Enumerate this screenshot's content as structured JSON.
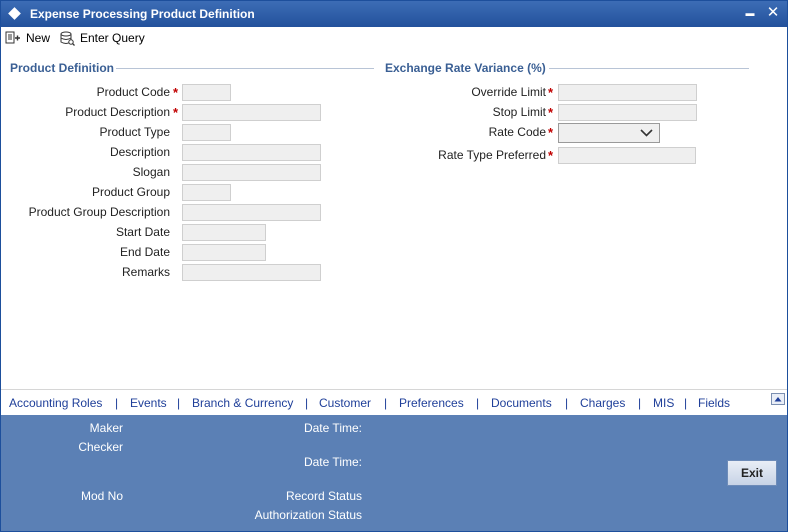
{
  "window": {
    "title": "Expense Processing Product Definition",
    "minimize_label": "▬",
    "close_label": "✕"
  },
  "toolbar": {
    "new_label": "New",
    "enter_query_label": "Enter Query"
  },
  "product_definition": {
    "heading": "Product Definition",
    "fields": {
      "product_code": {
        "label": "Product Code",
        "value": "",
        "required": true
      },
      "product_description": {
        "label": "Product Description",
        "value": "",
        "required": true
      },
      "product_type": {
        "label": "Product Type",
        "value": ""
      },
      "description": {
        "label": "Description",
        "value": ""
      },
      "slogan": {
        "label": "Slogan",
        "value": ""
      },
      "product_group": {
        "label": "Product Group",
        "value": ""
      },
      "product_group_description": {
        "label": "Product Group Description",
        "value": ""
      },
      "start_date": {
        "label": "Start Date",
        "value": ""
      },
      "end_date": {
        "label": "End Date",
        "value": ""
      },
      "remarks": {
        "label": "Remarks",
        "value": ""
      }
    }
  },
  "exchange_rate_variance": {
    "heading": "Exchange Rate Variance (%)",
    "fields": {
      "override_limit": {
        "label": "Override Limit",
        "value": "",
        "required": true
      },
      "stop_limit": {
        "label": "Stop Limit",
        "value": "",
        "required": true
      },
      "rate_code": {
        "label": "Rate Code",
        "value": "",
        "required": true
      },
      "rate_type_preferred": {
        "label": "Rate Type Preferred",
        "value": "",
        "required": true
      }
    }
  },
  "required_mark": "*",
  "tabs": {
    "separator": "|",
    "items": [
      "Accounting Roles",
      "Events",
      "Branch & Currency",
      "Customer",
      "Preferences",
      "Documents",
      "Charges",
      "MIS",
      "Fields"
    ]
  },
  "footer": {
    "maker": "Maker",
    "checker": "Checker",
    "date_time_1": "Date Time:",
    "date_time_2": "Date Time:",
    "mod_no": "Mod No",
    "record_status": "Record Status",
    "authorization_status": "Authorization Status",
    "exit_label": "Exit"
  },
  "colors": {
    "titlebar": "#23519c",
    "section_heading": "#3a5f94",
    "tab_link": "#1f3f99",
    "footer_bg": "#5b80b5",
    "required": "#c00000"
  }
}
